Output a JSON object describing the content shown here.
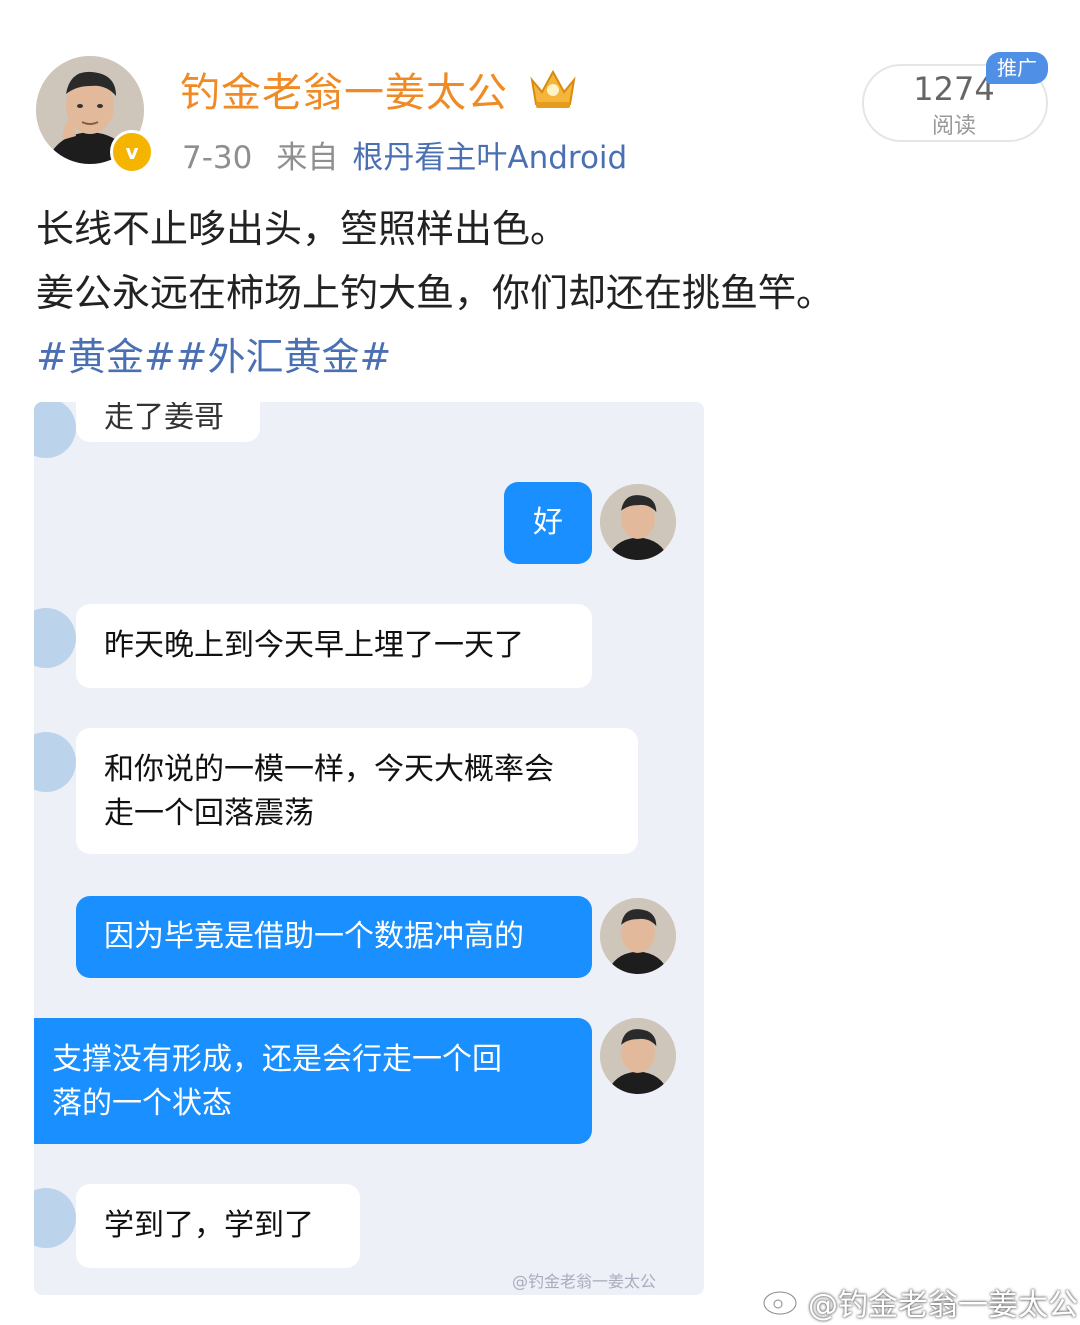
{
  "header": {
    "username": "钓金老翁一姜太公",
    "date": "7-30",
    "from_label": "来自",
    "source": "根丹看主叶Android",
    "read_count": "1274",
    "read_label": "阅读",
    "ad_tag": "推广",
    "verified_mark": "v",
    "icons": [
      "avatar",
      "verified-badge-icon",
      "crown-icon"
    ]
  },
  "post": {
    "line1": "长线不止哆出头，箜照样出色。",
    "line2": "姜公永远在柿场上钓大鱼，你们却还在挑鱼竿。",
    "hashtags": "#黄金##外汇黄金#"
  },
  "chat": {
    "top_partial": "走了姜哥",
    "messages": [
      {
        "side": "out",
        "text": "好"
      },
      {
        "side": "in",
        "text": "昨天晚上到今天早上埋了一天了"
      },
      {
        "side": "in",
        "lines": [
          "和你说的一模一样，今天大概率会",
          "走一个回落震荡"
        ]
      },
      {
        "side": "out",
        "text": "因为毕竟是借助一个数据冲高的"
      },
      {
        "side": "out",
        "lines": [
          "支撑没有形成，还是会行走一个回",
          "落的一个状态"
        ]
      },
      {
        "side": "in",
        "text": "学到了，学到了"
      }
    ],
    "inner_watermark": "@钓金老翁一姜太公"
  },
  "watermark": "@钓金老翁一姜太公",
  "colors": {
    "username": "#f08a24",
    "link": "#4a6fb3",
    "bubble_out": "#1a8fff",
    "chat_bg": "#eef0f8",
    "ad_tag": "#4f8fe6"
  }
}
